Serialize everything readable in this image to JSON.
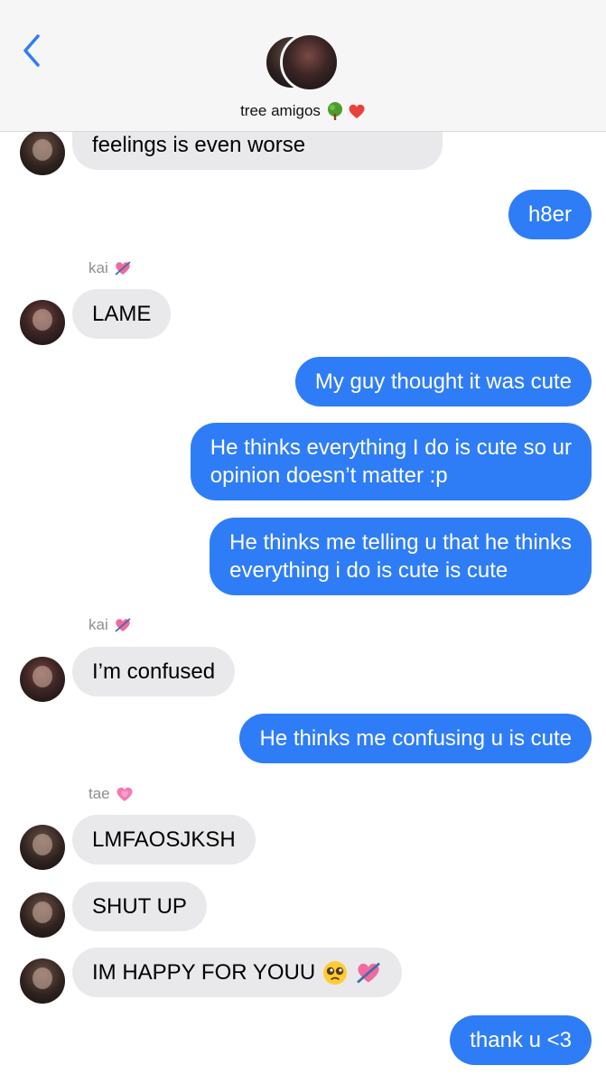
{
  "header": {
    "group_name": "tree amigos",
    "back_icon": "chevron-left-icon",
    "group_emojis": [
      "tree-emoji",
      "red-heart-emoji"
    ]
  },
  "colors": {
    "outgoing": "#2f7df6",
    "incoming": "#e9e9eb",
    "accent": "#2f7df6"
  },
  "messages": [
    {
      "side": "in",
      "text": "feelings is even worse"
    },
    {
      "side": "out",
      "text": "h8er"
    },
    {
      "side": "sender",
      "text": "kai"
    },
    {
      "side": "in",
      "text": "LAME"
    },
    {
      "side": "out",
      "text": "My guy thought it was cute"
    },
    {
      "side": "out",
      "text": "He thinks everything I do is cute so ur\nopinion doesn’t matter :p"
    },
    {
      "side": "out",
      "text": "He thinks me telling u that he thinks\neverything i do is cute is cute"
    },
    {
      "side": "sender",
      "text": "kai"
    },
    {
      "side": "in",
      "text": "I’m confused"
    },
    {
      "side": "out",
      "text": "He thinks me confusing u is cute"
    },
    {
      "side": "sender",
      "text": "tae"
    },
    {
      "side": "in",
      "text": "LMFAOSJKSH"
    },
    {
      "side": "in",
      "text": "SHUT UP"
    },
    {
      "side": "in",
      "text": "IM HAPPY FOR YOUU"
    },
    {
      "side": "out",
      "text": "thank u <3"
    }
  ]
}
